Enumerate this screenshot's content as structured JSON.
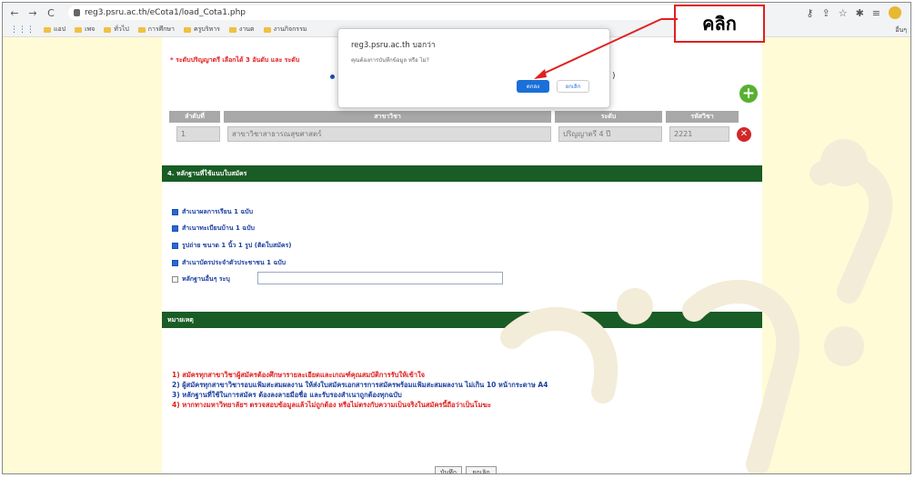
{
  "browser": {
    "url": "reg3.psru.ac.th/eCota1/load_Cota1.php",
    "bookmarks": [
      "แอป",
      "เพจ",
      "ทั่วไป",
      "การศึกษา",
      "ครูบริหาร",
      "งานต",
      "งานกิจกรรม"
    ],
    "bookmark_right": "อื่นๆ"
  },
  "page": {
    "requirement_note": "* ระดับปริญญาตรี เลือกได้ 3 อันดับ และ ระดับ",
    "paren_text": ")",
    "table": {
      "headers": [
        "ลำดับที่",
        "สาขาวิชา",
        "ระดับ",
        "รหัสวิชา"
      ],
      "row": [
        "1",
        "สาขาวิชาสาธารณสุขศาสตร์",
        "ปริญญาตรี 4 ปี",
        "2221"
      ]
    },
    "section_docs_title": "4. หลักฐานที่ใช้แนบใบสมัคร",
    "documents": [
      {
        "label": "สำเนาผลการเรียน 1 ฉบับ",
        "checked": true
      },
      {
        "label": "สำเนาทะเบียนบ้าน 1 ฉบับ",
        "checked": true
      },
      {
        "label": "รูปถ่าย ขนาด 1 นิ้ว 1 รูป (ติดใบสมัคร)",
        "checked": true
      },
      {
        "label": "สำเนาบัตรประจำตัวประชาชน 1 ฉบับ",
        "checked": true
      },
      {
        "label": "หลักฐานอื่นๆ ระบุ",
        "checked": false
      }
    ],
    "section_remarks_title": "หมายเหตุ",
    "remarks": [
      {
        "text": "1) สมัครทุกสาขาวิชาผู้สมัครต้องศึกษารายละเอียดและเกณฑ์คุณสมบัติการรับให้เข้าใจ",
        "color": "red"
      },
      {
        "text": "2) ผู้สมัครทุกสาขาวิชารอบแฟ้มสะสมผลงาน ให้ส่งใบสมัครเอกสารการสมัครพร้อมแฟ้มสะสมผลงาน ไม่เกิน 10 หน้ากระดาษ A4",
        "color": "blue"
      },
      {
        "text": "3) หลักฐานที่ใช้ในการสมัคร ต้องลงลายมือชื่อ และรับรองสำเนาถูกต้องทุกฉบับ",
        "color": "blue"
      },
      {
        "text": "4) หากทางมหาวิทยาลัยฯ ตรวจสอบข้อมูลแล้วไม่ถูกต้อง หรือไม่ตรงกับความเป็นจริงในสมัครนี้ถือว่าเป็นโมฆะ",
        "color": "red"
      }
    ],
    "save_label": "บันทึก",
    "cancel_label": "ยกเลิก"
  },
  "dialog": {
    "title": "reg3.psru.ac.th บอกว่า",
    "message": "คุณต้องการบันทึกข้อมูล หรือ ไม่?",
    "ok_label": "ตกลง",
    "cancel_label": "ยกเลิก"
  },
  "annotation": {
    "label": "คลิก",
    "color": "#e02020"
  },
  "colors": {
    "section_bar": "#195c25",
    "page_bg": "#fffbd6",
    "dialog_ok": "#1a6fd8"
  }
}
